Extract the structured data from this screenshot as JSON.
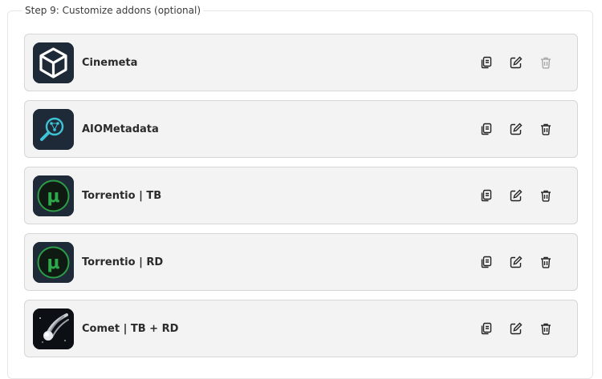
{
  "section": {
    "legend": "Step 9: Customize addons (optional)"
  },
  "addons": [
    {
      "name": "Cinemeta",
      "logo": "box-icon",
      "delete_enabled": false
    },
    {
      "name": "AIOMetadata",
      "logo": "search-network-icon",
      "delete_enabled": true
    },
    {
      "name": "Torrentio | TB",
      "logo": "mu-icon",
      "delete_enabled": true
    },
    {
      "name": "Torrentio | RD",
      "logo": "mu-icon",
      "delete_enabled": true
    },
    {
      "name": "Comet | TB + RD",
      "logo": "comet-icon",
      "delete_enabled": true
    }
  ],
  "actions": {
    "copy": "copy-icon",
    "edit": "edit-icon",
    "delete": "trash-icon"
  }
}
